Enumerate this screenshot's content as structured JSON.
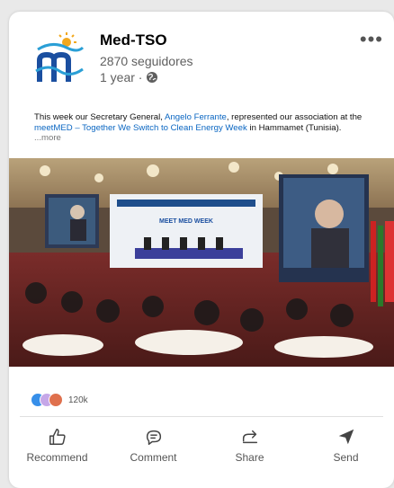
{
  "post": {
    "author": "Med-TSO",
    "followers": "2870 seguidores",
    "time": "1 year ·",
    "text_before": "This week our Secretary General, ",
    "mention": "Angelo Ferrante",
    "text_middle": ", represented our association at the ",
    "event_link": "meetMED – Together We Switch to Clean Energy Week",
    "text_after": " in Hammamet (Tunisia). ",
    "more": "...more",
    "photo_banner": "MEET MED WEEK"
  },
  "social": {
    "reaction_count": "120k",
    "reaction_colors": [
      "#378fe9",
      "#c37d16",
      "#df704d"
    ]
  },
  "actions": {
    "recommend": "Recommend",
    "comment": "Comment",
    "share": "Share",
    "send": "Send"
  },
  "colors": {
    "link": "#0a66c2",
    "background": "#e9e9e9",
    "card": "#ffffff"
  }
}
